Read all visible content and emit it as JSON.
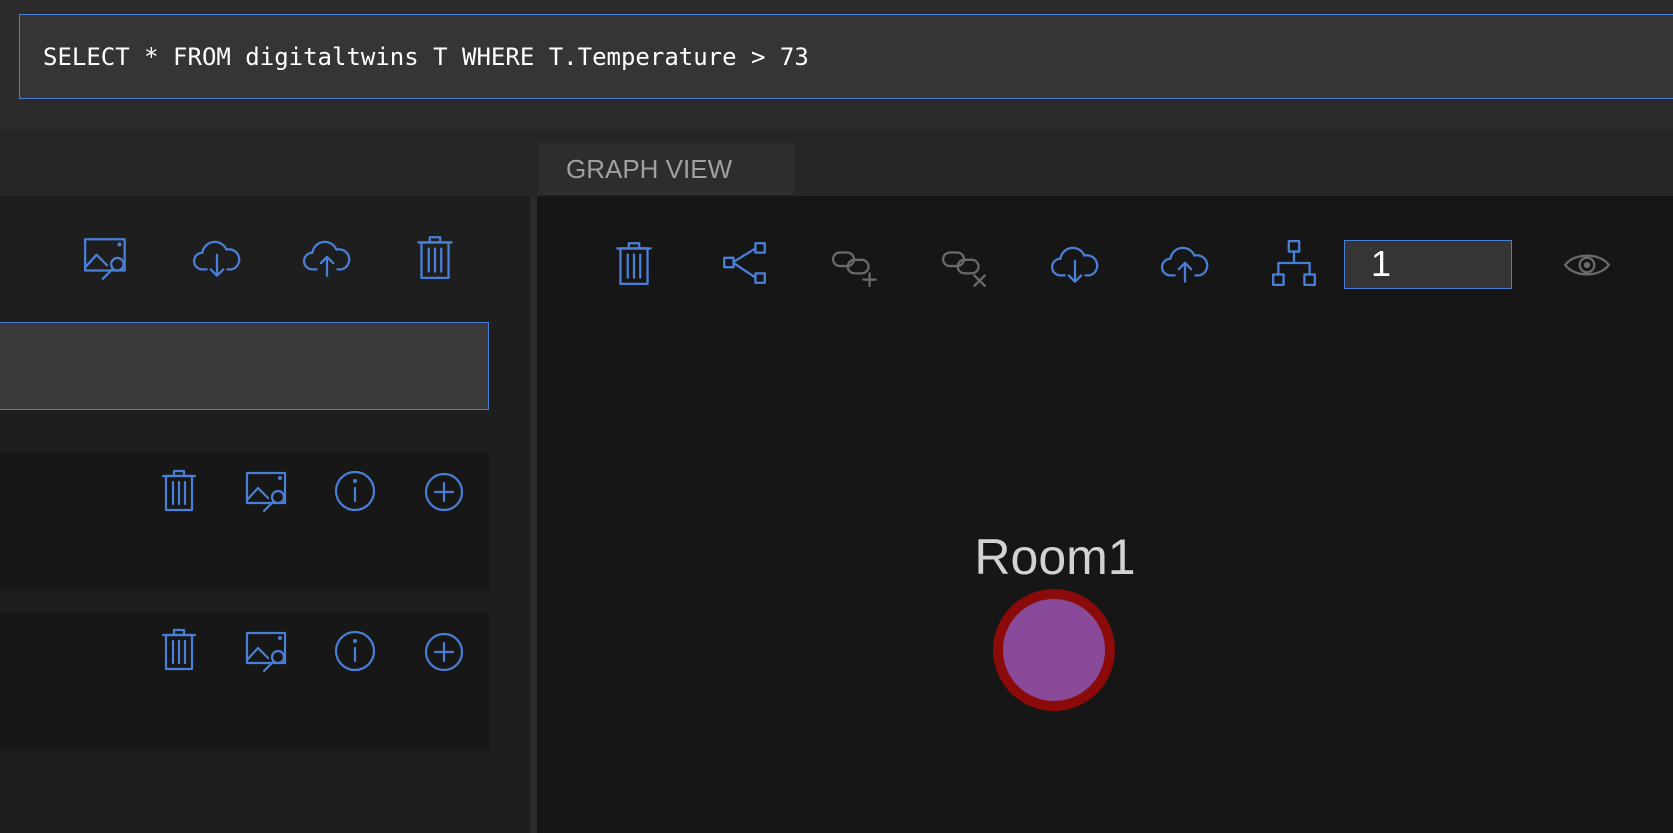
{
  "query": {
    "text": "SELECT * FROM digitaltwins T WHERE T.Temperature > 73"
  },
  "tabs": {
    "graph_view_label": "GRAPH VIEW"
  },
  "left_toolbar": {
    "icons": [
      "image-search-icon",
      "cloud-download-icon",
      "cloud-upload-icon",
      "trash-icon"
    ]
  },
  "model_card_icons": [
    "trash-icon",
    "image-search-icon",
    "info-icon",
    "add-circle-icon"
  ],
  "graph_toolbar": {
    "icons": [
      "trash-icon",
      "share-relationships-icon",
      "link-add-icon",
      "link-remove-icon",
      "cloud-download-icon",
      "cloud-upload-icon",
      "hierarchy-icon",
      "eye-icon"
    ],
    "depth_value": "1"
  },
  "graph": {
    "nodes": [
      {
        "label": "Room1",
        "fill": "#8a4a9a",
        "border": "#8b0a0a"
      }
    ]
  },
  "colors": {
    "accent": "#4a7fd8",
    "disabled": "#6a6a6a"
  }
}
